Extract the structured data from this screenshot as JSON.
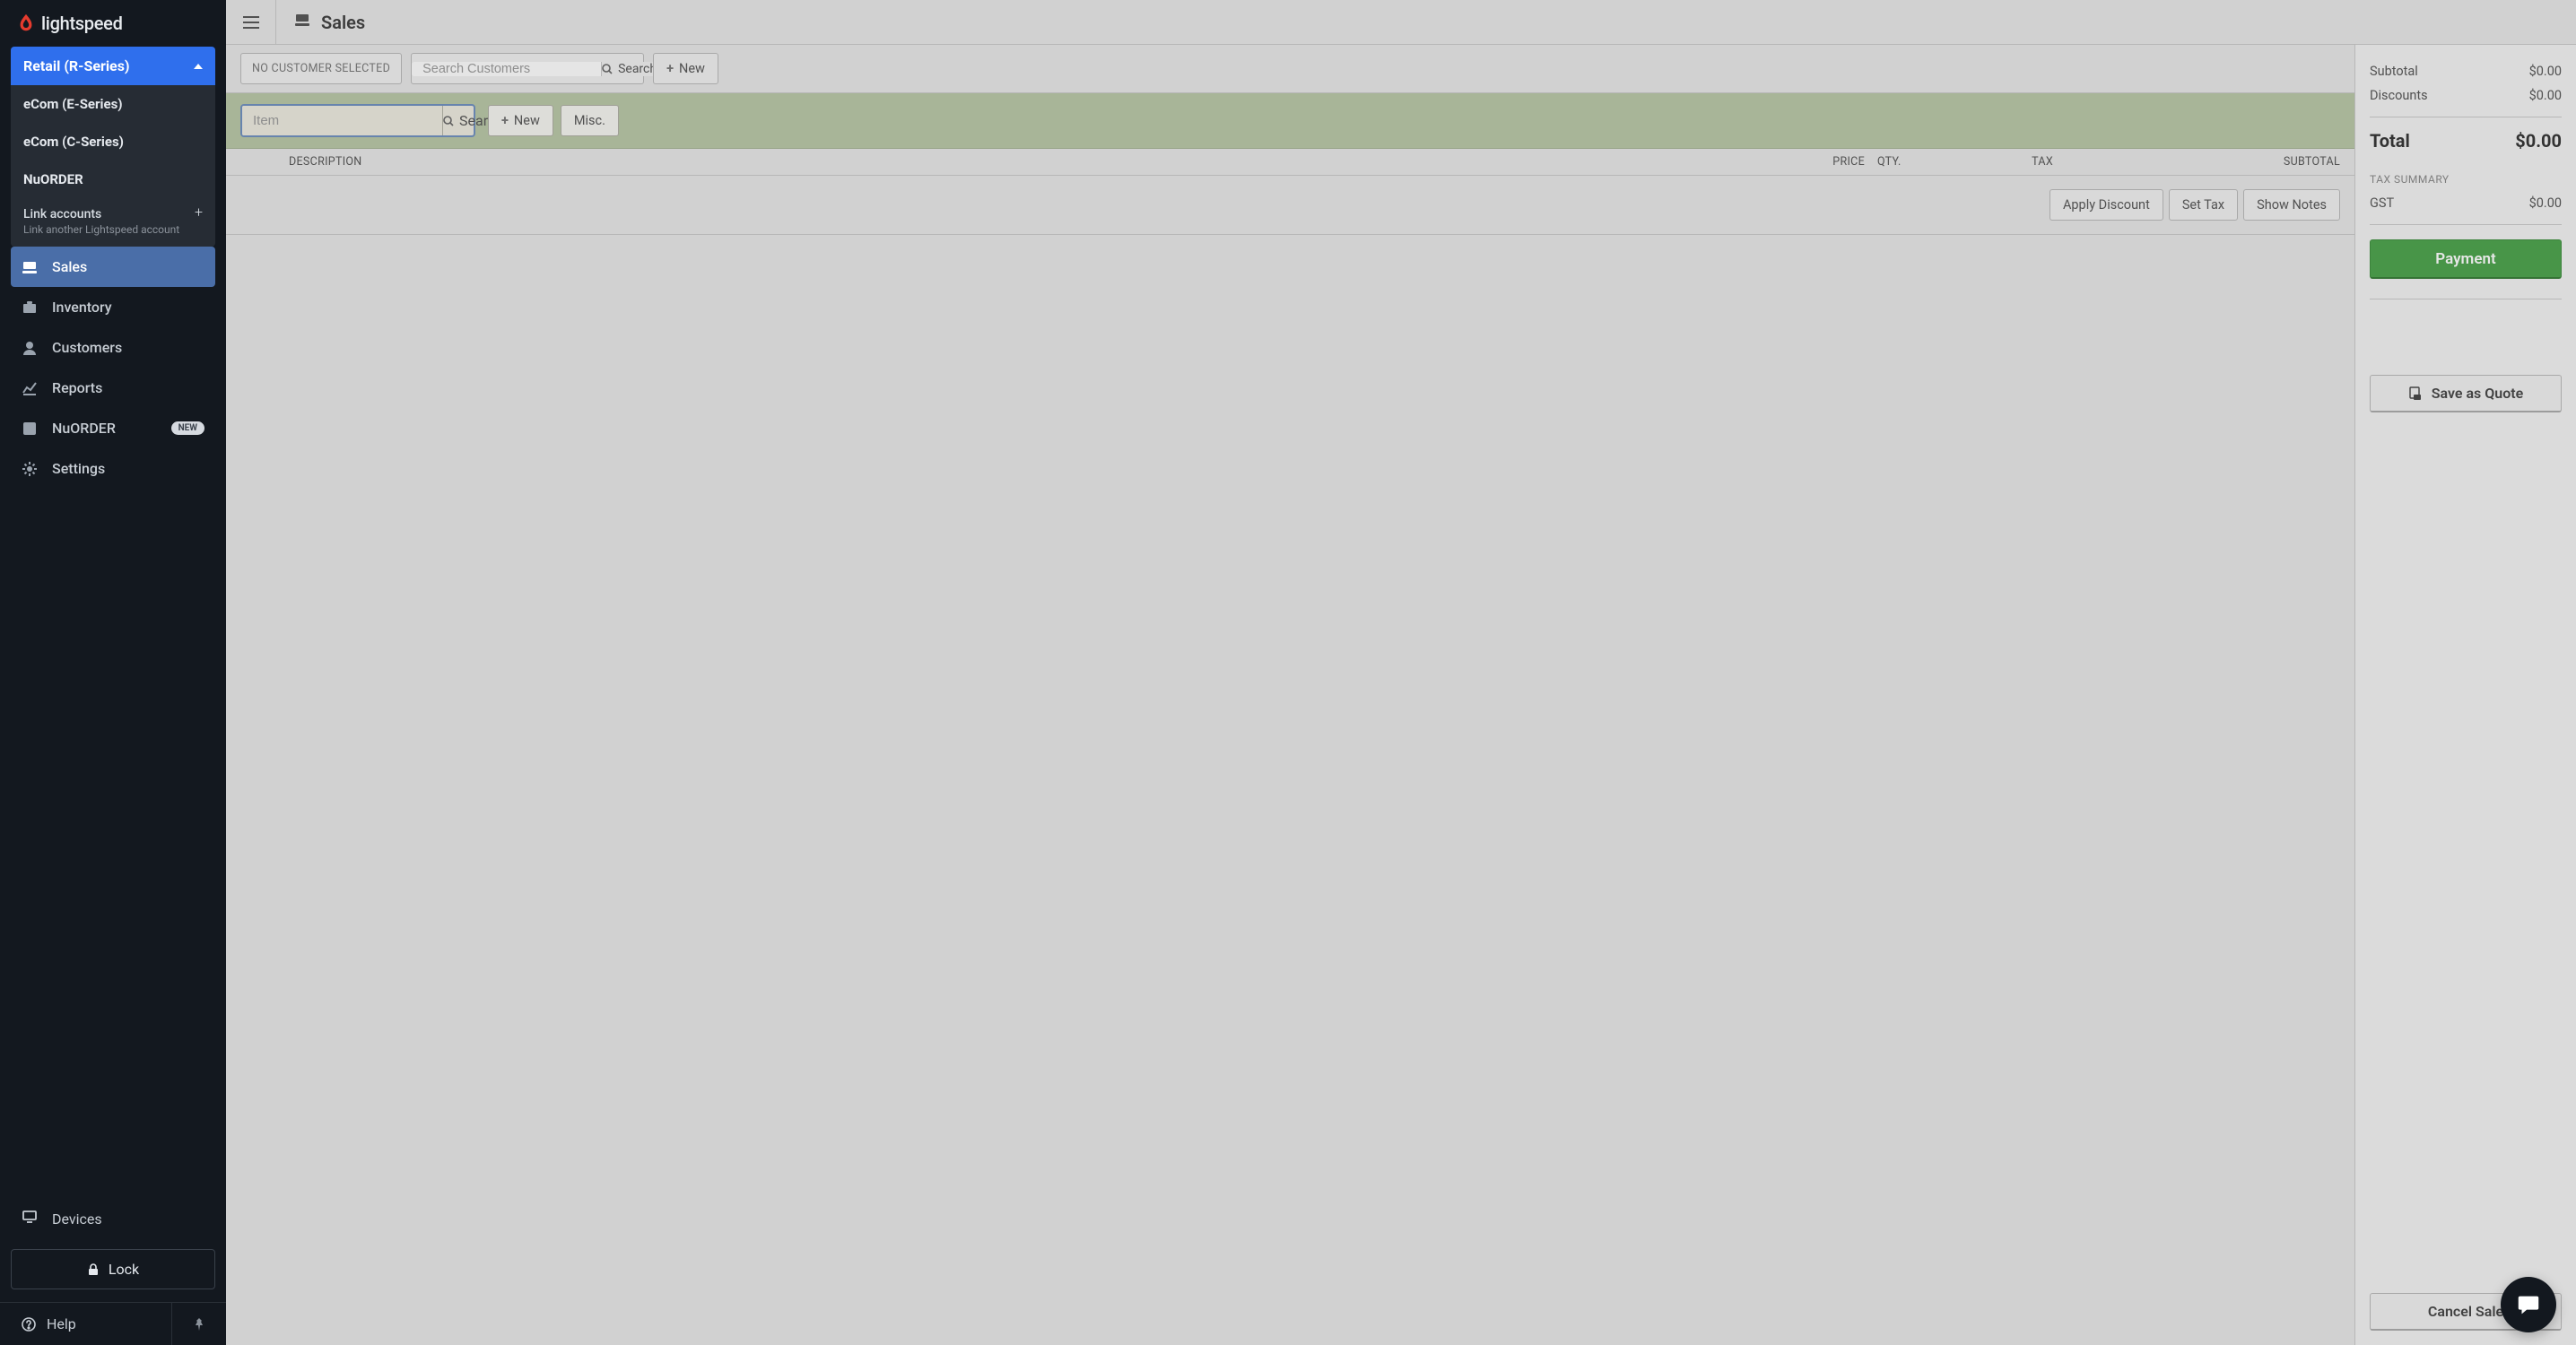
{
  "app": {
    "name": "lightspeed"
  },
  "seriesDropdown": {
    "selected": "Retail (R-Series)",
    "options": [
      "eCom (E-Series)",
      "eCom (C-Series)",
      "NuORDER"
    ],
    "link": {
      "title": "Link accounts",
      "subtitle": "Link another Lightspeed account"
    }
  },
  "sidebar": {
    "items": {
      "sales": "Sales",
      "inventory": "Inventory",
      "customers": "Customers",
      "reports": "Reports",
      "nuorder": "NuORDER",
      "nuorder_badge": "NEW",
      "settings": "Settings",
      "devices": "Devices"
    },
    "lock": "Lock",
    "help": "Help"
  },
  "header": {
    "title": "Sales"
  },
  "customerBar": {
    "noCustomer": "NO CUSTOMER SELECTED",
    "searchPlaceholder": "Search Customers",
    "searchBtn": "Search",
    "newBtn": "New"
  },
  "itemBar": {
    "placeholder": "Item",
    "searchBtn": "Search",
    "newBtn": "New",
    "miscBtn": "Misc."
  },
  "table": {
    "headers": {
      "description": "DESCRIPTION",
      "price": "PRICE",
      "qty": "QTY.",
      "tax": "TAX",
      "subtotal": "SUBTOTAL"
    }
  },
  "actions": {
    "applyDiscount": "Apply Discount",
    "setTax": "Set Tax",
    "showNotes": "Show Notes"
  },
  "summary": {
    "subtotalLabel": "Subtotal",
    "subtotalValue": "$0.00",
    "discountsLabel": "Discounts",
    "discountsValue": "$0.00",
    "totalLabel": "Total",
    "totalValue": "$0.00",
    "taxSummary": "TAX SUMMARY",
    "gstLabel": "GST",
    "gstValue": "$0.00",
    "payment": "Payment",
    "saveQuote": "Save as Quote",
    "cancel": "Cancel Sale"
  }
}
